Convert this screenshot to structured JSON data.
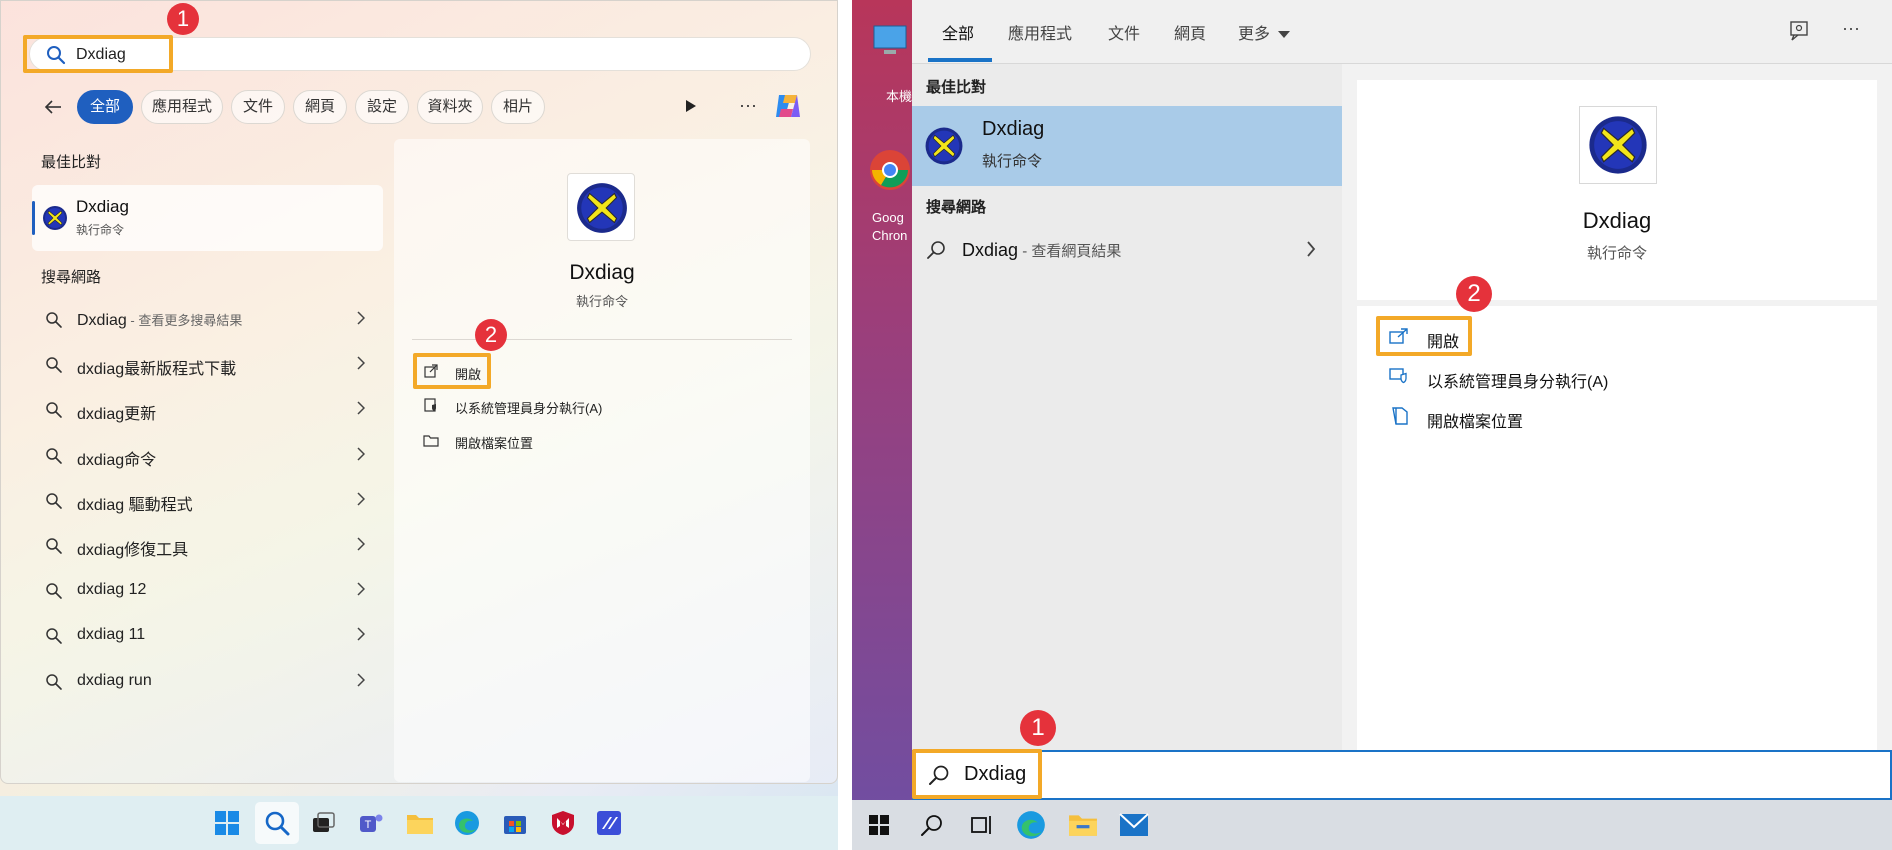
{
  "win11": {
    "search": {
      "value": "Dxdiag"
    },
    "callout_1": "1",
    "callout_2": "2",
    "filters": [
      {
        "label": "全部",
        "active": true
      },
      {
        "label": "應用程式"
      },
      {
        "label": "文件"
      },
      {
        "label": "網頁"
      },
      {
        "label": "設定"
      },
      {
        "label": "資料夾"
      },
      {
        "label": "相片"
      }
    ],
    "best_match_title": "最佳比對",
    "best_match": {
      "name": "Dxdiag",
      "type": "執行命令"
    },
    "web_title": "搜尋網路",
    "web_results": [
      {
        "label": "Dxdiag",
        "sub": " - 查看更多搜尋結果"
      },
      {
        "label": "dxdiag最新版程式下載",
        "sub": ""
      },
      {
        "label": "dxdiag更新",
        "sub": ""
      },
      {
        "label": "dxdiag命令",
        "sub": ""
      },
      {
        "label": "dxdiag 驅動程式",
        "sub": ""
      },
      {
        "label": "dxdiag修復工具",
        "sub": ""
      },
      {
        "label": "dxdiag 12",
        "sub": ""
      },
      {
        "label": "dxdiag 11",
        "sub": ""
      },
      {
        "label": "dxdiag run",
        "sub": ""
      }
    ],
    "preview": {
      "name": "Dxdiag",
      "type": "執行命令",
      "actions": [
        {
          "label": "開啟"
        },
        {
          "label": "以系統管理員身分執行(A)"
        },
        {
          "label": "開啟檔案位置"
        }
      ]
    },
    "taskbar_icons": [
      "windows-start-icon",
      "search-icon",
      "task-view-icon",
      "teams-icon",
      "file-explorer-icon",
      "edge-icon",
      "store-icon",
      "mcafee-icon",
      "app-icon"
    ]
  },
  "win10": {
    "tabs": [
      {
        "label": "全部",
        "active": true
      },
      {
        "label": "應用程式"
      },
      {
        "label": "文件"
      },
      {
        "label": "網頁"
      },
      {
        "label": "更多"
      }
    ],
    "best_match_title": "最佳比對",
    "best_match": {
      "name": "Dxdiag",
      "type": "執行命令"
    },
    "web_title": "搜尋網路",
    "web_result": {
      "label": "Dxdiag",
      "sub": " - 查看網頁結果"
    },
    "preview": {
      "name": "Dxdiag",
      "type": "執行命令",
      "actions": [
        {
          "label": "開啟"
        },
        {
          "label": "以系統管理員身分執行(A)"
        },
        {
          "label": "開啟檔案位置"
        }
      ]
    },
    "search": {
      "value": "Dxdiag"
    },
    "callout_1": "1",
    "callout_2": "2",
    "desktop": {
      "pc_label": "本機",
      "chrome_label_1": "Goog",
      "chrome_label_2": "Chron"
    }
  },
  "colors": {
    "highlight": "#f3a928",
    "callout": "#e5323b",
    "accent11": "#1f5fbf",
    "accent10": "#1a73c7"
  }
}
